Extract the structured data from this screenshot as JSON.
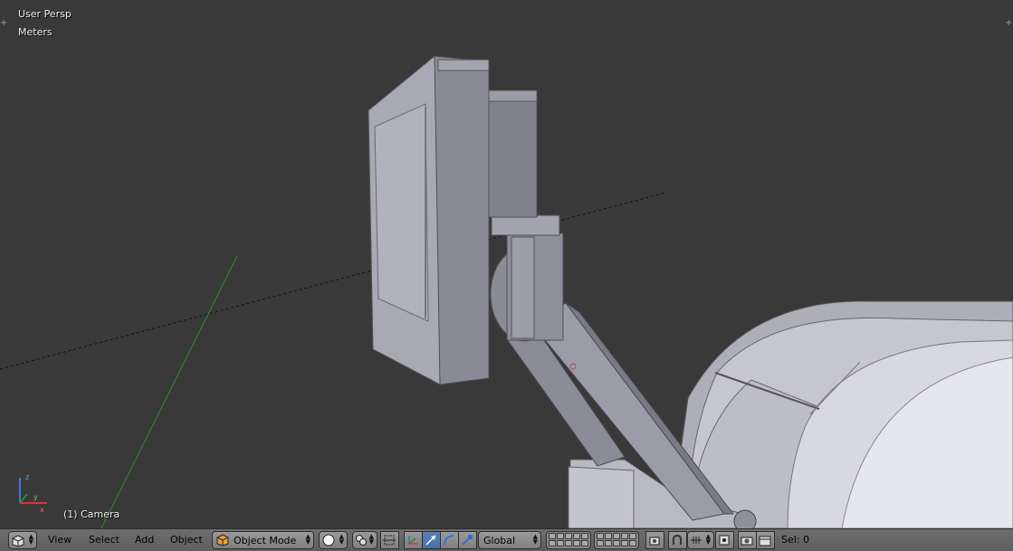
{
  "viewport": {
    "view_name": "User Persp",
    "units": "Meters",
    "active_object": "(1) Camera",
    "background": "#393939"
  },
  "header": {
    "editor_type_icon": "cube-icon",
    "menus": [
      "View",
      "Select",
      "Add",
      "Object"
    ],
    "mode": {
      "label": "Object Mode",
      "icon": "orange-cube-icon"
    },
    "viewport_shading_icon": "solid-sphere-icon",
    "pivot_icon": "pivot-point-icon",
    "manipulator_icons": [
      "manipulator-toggle-icon",
      "translate-manipulator-icon",
      "rotate-manipulator-icon",
      "scale-manipulator-icon"
    ],
    "transform_orientation": "Global",
    "snap_icons": [
      "lock-camera-icon",
      "magnet-icon",
      "snap-element-icon",
      "snap-target-icon"
    ],
    "render_icons": [
      "opengl-render-icon",
      "opengl-animation-icon"
    ],
    "selection_status": "Sel: 0",
    "colors": {
      "header_bg": "#686868",
      "active_button": "#4770aa"
    }
  }
}
